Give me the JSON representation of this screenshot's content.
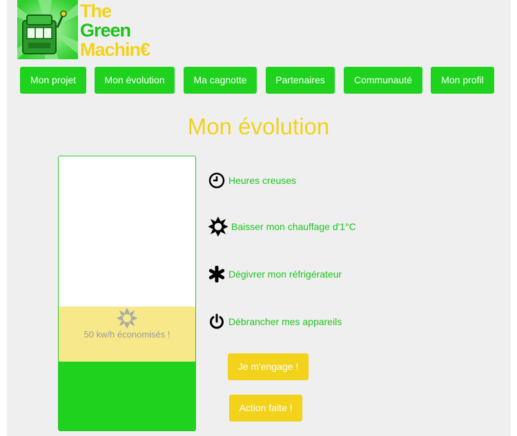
{
  "logo": {
    "line1": "The",
    "line2": "Green",
    "line3": "Machin€"
  },
  "nav": {
    "items": [
      {
        "label": "Mon projet"
      },
      {
        "label": "Mon évolution"
      },
      {
        "label": "Ma cagnotte"
      },
      {
        "label": "Partenaires"
      },
      {
        "label": "Communauté"
      },
      {
        "label": "Mon profil"
      }
    ]
  },
  "page_title": "Mon évolution",
  "meter": {
    "saved_text": "50 kw/h économisés !",
    "icon": "sun-icon"
  },
  "actions": [
    {
      "icon": "clock-icon",
      "label": "Heures creuses"
    },
    {
      "icon": "sun-icon",
      "label": "Baisser mon chauffage d'1°C"
    },
    {
      "icon": "asterisk-icon",
      "label": "Dégivrer mon réfrigérateur"
    },
    {
      "icon": "power-icon",
      "label": "Débrancher mes appareils"
    }
  ],
  "buttons": {
    "engage": "Je m'engage !",
    "done": "Action faite !"
  },
  "colors": {
    "green": "#1ed21e",
    "yellow": "#f2d21b",
    "meter_yellow": "#f7e98a",
    "page_bg": "#efefef"
  }
}
